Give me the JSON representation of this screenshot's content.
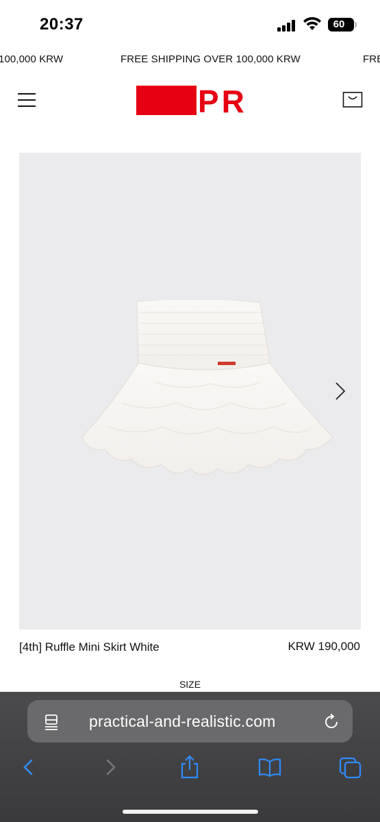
{
  "status_bar": {
    "time": "20:37",
    "battery": "60"
  },
  "announcement": {
    "items": [
      "100,000 KRW",
      "FREE SHIPPING OVER 100,000 KRW",
      "FREE"
    ]
  },
  "header": {
    "logo_text": "PR",
    "brand_color": "#e60012"
  },
  "product": {
    "name": "[4th] Ruffle Mini Skirt White",
    "price": "KRW 190,000",
    "size_label": "SIZE"
  },
  "browser": {
    "url": "practical-and-realistic.com",
    "accent_color": "#2f8cff"
  }
}
